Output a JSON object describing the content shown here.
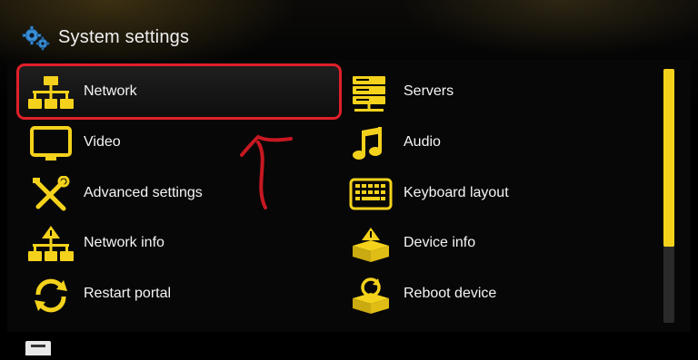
{
  "header": {
    "title": "System settings",
    "icon": "gears-icon"
  },
  "menu": {
    "left": [
      {
        "label": "Network",
        "icon": "network-icon",
        "selected": true
      },
      {
        "label": "Video",
        "icon": "monitor-icon"
      },
      {
        "label": "Advanced settings",
        "icon": "tools-icon"
      },
      {
        "label": "Network info",
        "icon": "network-info-icon"
      },
      {
        "label": "Restart portal",
        "icon": "restart-icon"
      }
    ],
    "right": [
      {
        "label": "Servers",
        "icon": "servers-icon"
      },
      {
        "label": "Audio",
        "icon": "music-note-icon"
      },
      {
        "label": "Keyboard layout",
        "icon": "keyboard-icon"
      },
      {
        "label": "Device info",
        "icon": "device-info-icon"
      },
      {
        "label": "Reboot device",
        "icon": "reboot-icon"
      }
    ]
  },
  "colors": {
    "accent": "#f4d21c",
    "selection_outline": "#e0202a",
    "text": "#f5f5f5"
  },
  "scroll": {
    "position_fraction": 0.0,
    "visible_fraction": 0.7
  }
}
